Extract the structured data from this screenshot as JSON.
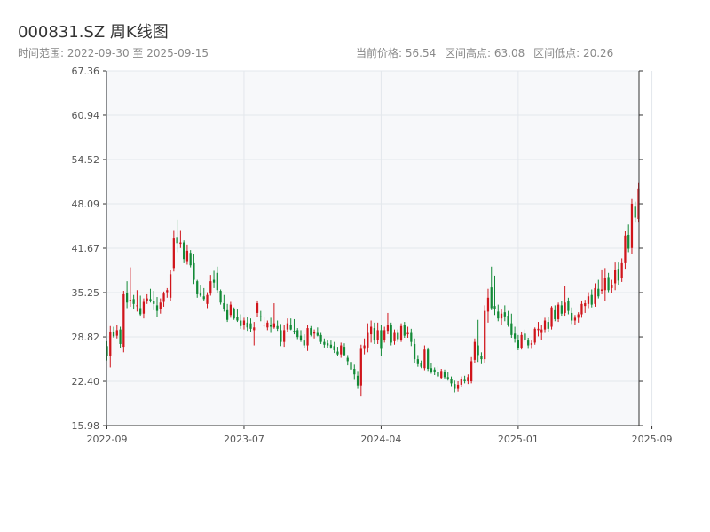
{
  "header": {
    "title": "000831.SZ 周K线图",
    "range_text": "时间范围: 2022-09-30 至 2025-09-15",
    "current_price_text": "当前价格: 56.54",
    "high_text": "区间高点: 63.08",
    "low_text": "区间低点: 20.26"
  },
  "chart_data": {
    "type": "candlestick",
    "title": "000831.SZ 周K线图",
    "xlabel": "",
    "ylabel": "",
    "ylim": [
      15.98,
      67.36
    ],
    "grid": true,
    "y_ticks": [
      15.98,
      22.4,
      28.82,
      35.25,
      41.67,
      48.09,
      54.52,
      60.94,
      67.36
    ],
    "x_ticks": [
      {
        "label": "2022-09",
        "index": 0
      },
      {
        "label": "2023-07",
        "index": 41
      },
      {
        "label": "2024-04",
        "index": 82
      },
      {
        "label": "2025-01",
        "index": 123
      },
      {
        "label": "2025-09",
        "index": 163
      }
    ],
    "colors": {
      "up": "#d0151b",
      "down": "#138a37",
      "grid": "#e3e7ec",
      "plot_bg": "#f7f8fa",
      "axis": "#333333"
    },
    "ohlc": [
      [
        27.5,
        28.2,
        25.4,
        26.0
      ],
      [
        26.1,
        30.4,
        24.4,
        29.6
      ],
      [
        29.5,
        30.3,
        28.7,
        28.9
      ],
      [
        29.0,
        30.5,
        28.6,
        29.8
      ],
      [
        29.9,
        30.3,
        27.2,
        27.8
      ],
      [
        27.4,
        35.5,
        26.6,
        35.0
      ],
      [
        35.2,
        36.9,
        33.0,
        33.8
      ],
      [
        34.1,
        38.9,
        33.2,
        34.2
      ],
      [
        34.3,
        34.9,
        32.8,
        33.6
      ],
      [
        33.3,
        35.6,
        32.5,
        33.4
      ],
      [
        33.0,
        34.8,
        31.9,
        32.1
      ],
      [
        32.2,
        34.4,
        31.5,
        33.9
      ],
      [
        34.1,
        35.0,
        33.6,
        34.4
      ],
      [
        34.3,
        35.8,
        33.8,
        34.0
      ],
      [
        34.0,
        35.5,
        32.7,
        33.6
      ],
      [
        33.4,
        34.6,
        31.7,
        32.6
      ],
      [
        32.9,
        34.4,
        32.2,
        33.8
      ],
      [
        33.9,
        35.4,
        33.2,
        35.1
      ],
      [
        35.3,
        35.9,
        34.5,
        35.6
      ],
      [
        34.5,
        38.5,
        34.0,
        37.9
      ],
      [
        38.8,
        44.3,
        38.3,
        43.2
      ],
      [
        43.3,
        45.8,
        41.1,
        42.4
      ],
      [
        42.3,
        44.3,
        41.7,
        42.5
      ],
      [
        42.5,
        42.8,
        39.5,
        40.1
      ],
      [
        39.8,
        42.2,
        39.3,
        41.3
      ],
      [
        41.0,
        41.4,
        38.9,
        39.2
      ],
      [
        39.5,
        40.9,
        36.5,
        37.1
      ],
      [
        36.9,
        37.1,
        34.5,
        35.0
      ],
      [
        35.1,
        36.4,
        34.6,
        34.8
      ],
      [
        34.7,
        35.9,
        34.0,
        34.3
      ],
      [
        33.6,
        35.3,
        33.0,
        34.9
      ],
      [
        35.1,
        37.8,
        34.8,
        36.9
      ],
      [
        37.1,
        38.4,
        35.9,
        36.7
      ],
      [
        38.1,
        39.0,
        35.2,
        35.6
      ],
      [
        35.5,
        35.7,
        33.5,
        33.8
      ],
      [
        33.7,
        34.9,
        32.5,
        32.9
      ],
      [
        32.7,
        33.6,
        31.0,
        31.3
      ],
      [
        32.0,
        33.9,
        31.6,
        33.5
      ],
      [
        32.9,
        33.1,
        31.3,
        31.5
      ],
      [
        31.7,
        32.8,
        31.0,
        31.2
      ],
      [
        31.2,
        32.1,
        30.0,
        30.4
      ],
      [
        30.5,
        31.6,
        29.9,
        31.2
      ],
      [
        30.9,
        31.7,
        29.7,
        30.2
      ],
      [
        30.8,
        31.5,
        29.5,
        30.0
      ],
      [
        29.8,
        31.0,
        27.6,
        30.2
      ],
      [
        32.3,
        34.1,
        31.7,
        33.7
      ],
      [
        31.8,
        32.6,
        31.1,
        31.7
      ],
      [
        30.5,
        31.7,
        30.2,
        30.6
      ],
      [
        30.2,
        31.2,
        29.8,
        30.9
      ],
      [
        30.5,
        31.6,
        29.4,
        30.3
      ],
      [
        30.2,
        33.7,
        30.0,
        30.8
      ],
      [
        30.4,
        31.2,
        29.7,
        30.0
      ],
      [
        29.8,
        30.7,
        27.5,
        28.1
      ],
      [
        28.1,
        30.5,
        27.4,
        29.8
      ],
      [
        29.9,
        31.5,
        29.5,
        30.8
      ],
      [
        30.6,
        31.5,
        29.8,
        29.9
      ],
      [
        29.7,
        31.4,
        29.2,
        29.6
      ],
      [
        29.8,
        30.1,
        28.5,
        28.8
      ],
      [
        29.0,
        29.8,
        28.1,
        28.4
      ],
      [
        28.3,
        29.2,
        27.2,
        27.6
      ],
      [
        27.6,
        30.5,
        26.8,
        30.1
      ],
      [
        30.1,
        30.4,
        28.9,
        29.1
      ],
      [
        29.3,
        29.9,
        28.6,
        29.5
      ],
      [
        29.4,
        30.2,
        28.9,
        29.0
      ],
      [
        29.1,
        29.4,
        27.8,
        28.1
      ],
      [
        28.1,
        28.6,
        27.3,
        27.7
      ],
      [
        27.9,
        28.3,
        27.2,
        27.6
      ],
      [
        27.7,
        28.3,
        27.1,
        27.3
      ],
      [
        27.5,
        28.1,
        26.5,
        26.9
      ],
      [
        26.7,
        27.4,
        26.1,
        26.3
      ],
      [
        26.3,
        28.0,
        25.8,
        27.6
      ],
      [
        27.4,
        27.9,
        26.0,
        26.2
      ],
      [
        25.8,
        26.2,
        24.7,
        25.3
      ],
      [
        25.2,
        25.5,
        23.8,
        24.1
      ],
      [
        24.2,
        24.8,
        22.6,
        23.4
      ],
      [
        23.2,
        23.9,
        21.3,
        21.8
      ],
      [
        21.8,
        27.7,
        20.2,
        27.1
      ],
      [
        27.1,
        28.6,
        26.3,
        27.6
      ],
      [
        27.3,
        30.8,
        26.6,
        29.4
      ],
      [
        29.2,
        31.2,
        28.0,
        30.3
      ],
      [
        30.1,
        30.9,
        27.8,
        28.3
      ],
      [
        28.4,
        30.9,
        27.8,
        29.8
      ],
      [
        29.8,
        30.6,
        26.1,
        27.1
      ],
      [
        28.4,
        30.3,
        28.0,
        29.8
      ],
      [
        29.7,
        32.3,
        29.2,
        30.6
      ],
      [
        30.6,
        30.9,
        27.6,
        28.0
      ],
      [
        28.2,
        29.9,
        27.7,
        29.4
      ],
      [
        29.4,
        29.9,
        28.1,
        28.5
      ],
      [
        28.4,
        30.8,
        28.1,
        30.4
      ],
      [
        30.5,
        31.0,
        28.7,
        29.0
      ],
      [
        29.2,
        30.3,
        28.7,
        29.4
      ],
      [
        29.4,
        30.0,
        27.5,
        28.1
      ],
      [
        27.8,
        28.6,
        25.1,
        25.6
      ],
      [
        25.6,
        26.2,
        24.5,
        25.0
      ],
      [
        25.1,
        25.4,
        24.3,
        24.5
      ],
      [
        24.3,
        27.6,
        24.0,
        27.0
      ],
      [
        27.0,
        27.3,
        23.9,
        24.2
      ],
      [
        24.3,
        25.1,
        23.5,
        23.8
      ],
      [
        24.1,
        24.4,
        23.3,
        23.7
      ],
      [
        23.8,
        24.6,
        22.9,
        23.1
      ],
      [
        22.9,
        24.2,
        22.7,
        23.9
      ],
      [
        23.7,
        24.1,
        22.8,
        23.0
      ],
      [
        23.0,
        23.8,
        22.5,
        22.8
      ],
      [
        22.7,
        23.1,
        21.7,
        22.1
      ],
      [
        22.0,
        22.5,
        20.8,
        21.3
      ],
      [
        21.3,
        22.4,
        20.9,
        21.9
      ],
      [
        21.9,
        23.1,
        21.6,
        22.7
      ],
      [
        22.6,
        23.2,
        22.1,
        22.4
      ],
      [
        22.4,
        23.4,
        22.0,
        23.0
      ],
      [
        22.4,
        25.9,
        22.1,
        25.3
      ],
      [
        25.5,
        28.6,
        25.1,
        28.1
      ],
      [
        27.6,
        31.3,
        25.2,
        26.2
      ],
      [
        26.1,
        26.6,
        25.0,
        25.6
      ],
      [
        25.6,
        33.4,
        25.1,
        32.6
      ],
      [
        32.5,
        35.8,
        30.9,
        34.5
      ],
      [
        36.0,
        39.0,
        32.7,
        33.0
      ],
      [
        33.3,
        37.7,
        32.0,
        32.9
      ],
      [
        32.5,
        33.5,
        31.1,
        31.5
      ],
      [
        31.5,
        32.8,
        30.6,
        32.2
      ],
      [
        32.4,
        33.4,
        31.1,
        31.8
      ],
      [
        31.9,
        32.6,
        30.3,
        30.6
      ],
      [
        30.8,
        32.2,
        28.7,
        29.1
      ],
      [
        29.3,
        30.3,
        28.0,
        28.6
      ],
      [
        28.4,
        29.1,
        26.9,
        27.2
      ],
      [
        27.2,
        29.6,
        27.0,
        29.1
      ],
      [
        29.3,
        29.9,
        28.1,
        28.4
      ],
      [
        28.3,
        28.7,
        27.1,
        27.6
      ],
      [
        27.7,
        28.3,
        27.1,
        27.9
      ],
      [
        28.0,
        30.2,
        27.7,
        30.0
      ],
      [
        29.8,
        31.0,
        28.9,
        30.0
      ],
      [
        29.4,
        30.6,
        28.4,
        29.9
      ],
      [
        29.9,
        31.6,
        29.4,
        31.2
      ],
      [
        31.0,
        31.7,
        29.6,
        30.0
      ],
      [
        30.3,
        33.3,
        29.9,
        33.1
      ],
      [
        32.7,
        33.4,
        31.1,
        31.4
      ],
      [
        31.4,
        33.8,
        31.0,
        33.5
      ],
      [
        33.4,
        34.0,
        31.9,
        32.2
      ],
      [
        32.3,
        36.2,
        31.9,
        33.8
      ],
      [
        34.0,
        34.5,
        32.1,
        32.6
      ],
      [
        32.3,
        33.1,
        30.7,
        31.2
      ],
      [
        31.2,
        32.0,
        30.5,
        31.6
      ],
      [
        31.6,
        32.4,
        30.9,
        32.1
      ],
      [
        32.1,
        34.1,
        31.6,
        33.6
      ],
      [
        33.3,
        34.2,
        32.3,
        33.7
      ],
      [
        33.6,
        35.3,
        33.0,
        34.7
      ],
      [
        34.9,
        35.7,
        33.1,
        33.5
      ],
      [
        33.6,
        36.6,
        33.2,
        35.9
      ],
      [
        35.8,
        37.1,
        34.4,
        34.7
      ],
      [
        35.5,
        38.6,
        35.0,
        35.7
      ],
      [
        35.6,
        38.8,
        34.0,
        37.4
      ],
      [
        37.5,
        38.1,
        35.3,
        35.6
      ],
      [
        35.9,
        37.1,
        35.2,
        36.4
      ],
      [
        36.6,
        39.6,
        35.6,
        38.5
      ],
      [
        38.7,
        39.6,
        36.4,
        37.0
      ],
      [
        37.3,
        40.2,
        36.8,
        39.5
      ],
      [
        39.5,
        44.2,
        38.7,
        43.5
      ],
      [
        43.6,
        45.1,
        41.1,
        41.6
      ],
      [
        41.7,
        48.9,
        40.9,
        48.1
      ],
      [
        47.8,
        48.4,
        45.5,
        46.1
      ],
      [
        45.9,
        51.2,
        45.5,
        50.3
      ]
    ]
  }
}
